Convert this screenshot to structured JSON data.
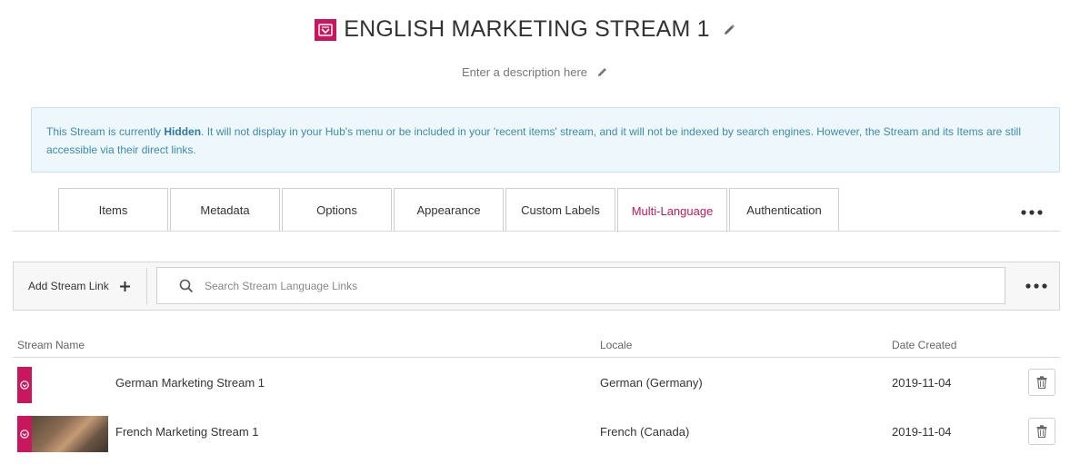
{
  "header": {
    "title": "ENGLISH MARKETING STREAM 1",
    "description_placeholder": "Enter a description here",
    "brand_color": "#c8175c"
  },
  "notice": {
    "text_before": "This Stream is currently ",
    "status": "Hidden",
    "text_after": ". It will not display in your Hub's menu or be included in your 'recent items' stream, and it will not be indexed by search engines. However, the Stream and its Items are still accessible via their direct links."
  },
  "tabs": [
    {
      "label": "Items",
      "active": false
    },
    {
      "label": "Metadata",
      "active": false
    },
    {
      "label": "Options",
      "active": false
    },
    {
      "label": "Appearance",
      "active": false
    },
    {
      "label": "Custom Labels",
      "active": false
    },
    {
      "label": "Multi-Language",
      "active": true
    },
    {
      "label": "Authentication",
      "active": false
    }
  ],
  "toolbar": {
    "add_link_label": "Add Stream Link",
    "search_placeholder": "Search Stream Language Links"
  },
  "table": {
    "columns": [
      "Stream Name",
      "Locale",
      "Date Created"
    ],
    "rows": [
      {
        "name": "German Marketing Stream 1",
        "locale": "German (Germany)",
        "date": "2019-11-04",
        "thumb": "brand-only"
      },
      {
        "name": "French Marketing Stream 1",
        "locale": "French (Canada)",
        "date": "2019-11-04",
        "thumb": "photo"
      }
    ]
  }
}
